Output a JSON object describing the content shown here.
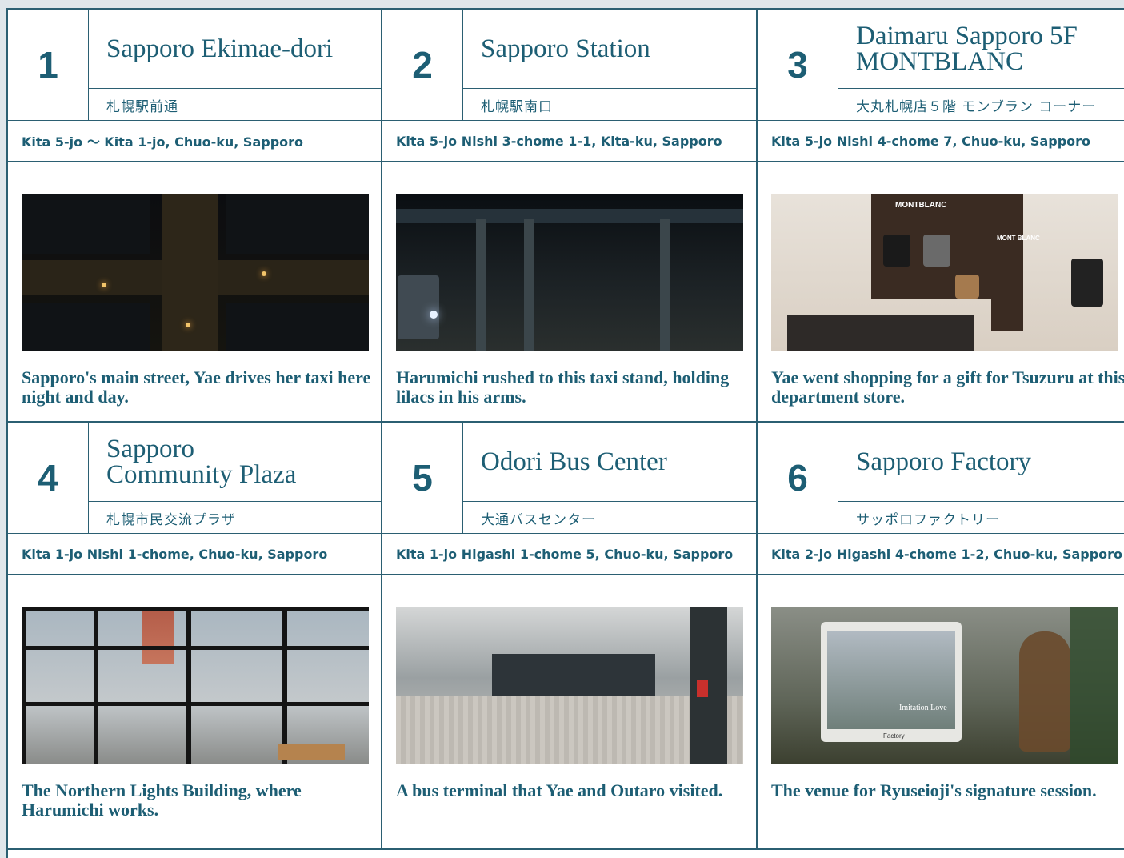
{
  "cards": [
    {
      "number": "1",
      "title_en": "Sapporo Ekimae-dori",
      "title_jp": "札幌駅前通",
      "address": "Kita 5-jo ～ Kita 1-jo, Chuo-ku, Sapporo",
      "description": "Sapporo's main street, Yae drives her taxi here night and day."
    },
    {
      "number": "2",
      "title_en": "Sapporo Station",
      "title_jp": "札幌駅南口",
      "address": "Kita 5-jo Nishi 3-chome 1-1, Kita-ku, Sapporo",
      "description": "Harumichi rushed to this taxi stand, holding lilacs in his arms."
    },
    {
      "number": "3",
      "title_en": "Daimaru Sapporo 5F\nMONTBLANC",
      "title_jp": "大丸札幌店５階 モンブラン コーナー",
      "address": "Kita 5-jo Nishi 4-chome 7, Chuo-ku, Sapporo",
      "description": "Yae went shopping for a gift for Tsuzuru at this department store.",
      "photo_text": [
        "MONTBLANC",
        "MONT BLANC"
      ]
    },
    {
      "number": "4",
      "title_en": "Sapporo\nCommunity Plaza",
      "title_jp": "札幌市民交流プラザ",
      "address": "Kita 1-jo Nishi 1-chome, Chuo-ku, Sapporo",
      "description": "The Northern Lights Building, where Harumichi works."
    },
    {
      "number": "5",
      "title_en": "Odori Bus Center",
      "title_jp": "大通バスセンター",
      "address": "Kita 1-jo Higashi 1-chome 5, Chuo-ku, Sapporo",
      "description": "A bus terminal that Yae and Outaro visited."
    },
    {
      "number": "6",
      "title_en": "Sapporo Factory",
      "title_jp": "サッポロファクトリー",
      "address": "Kita 2-jo Higashi 4-chome 1-2, Chuo-ku, Sapporo",
      "description": "The venue for Ryuseioji's signature session.",
      "photo_text": [
        "Imitation Love",
        "Factory"
      ]
    }
  ],
  "colors": {
    "primary": "#1d5e74",
    "border": "#2b5f72",
    "background": "#ffffff"
  }
}
